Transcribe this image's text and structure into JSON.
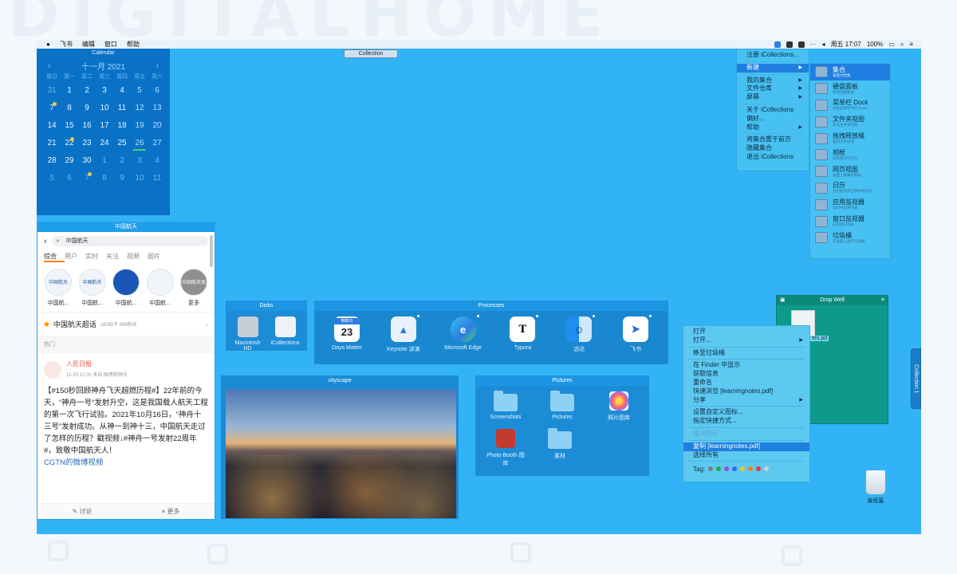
{
  "menubar": {
    "apple": "",
    "app_name": "飞书",
    "menus": [
      "编辑",
      "窗口",
      "帮助"
    ],
    "status_items": [
      "···",
      "周五 17:07",
      "100%"
    ]
  },
  "calendar": {
    "title": "Calendar",
    "month": "十一月 2021",
    "weekdays": [
      "周日",
      "周一",
      "周二",
      "周三",
      "周四",
      "周五",
      "周六"
    ],
    "weeks": [
      [
        "31",
        "1",
        "2",
        "3",
        "4",
        "5",
        "6"
      ],
      [
        "7",
        "8",
        "9",
        "10",
        "11",
        "12",
        "13"
      ],
      [
        "14",
        "15",
        "16",
        "17",
        "18",
        "19",
        "20"
      ],
      [
        "21",
        "22",
        "23",
        "24",
        "25",
        "26",
        "27"
      ],
      [
        "28",
        "29",
        "30",
        "1",
        "2",
        "3",
        "4"
      ],
      [
        "5",
        "6",
        "7",
        "8",
        "9",
        "10",
        "11"
      ]
    ]
  },
  "collection_tab": "Collection",
  "weibo": {
    "title": "中国航天",
    "search": "中国航天",
    "tabs": [
      "综合",
      "用户",
      "实时",
      "关注",
      "视频",
      "图片"
    ],
    "accounts": [
      "中国航...",
      "中国航...",
      "中国航...",
      "中国航...",
      "更多"
    ],
    "avatar_texts": [
      "中国航天",
      "中国航天",
      "",
      "",
      "中国航天局"
    ],
    "topic": "中国航天超话",
    "topic_meta": "283帖子 898粉丝",
    "hot": "热门",
    "poster": "人民日报",
    "post_meta": "11-20 12:00 来自 微博视频号",
    "post_text": "【#150秒回顾神舟飞天超燃历程#】22年前的今天，“神舟一号”发射升空，这是我国载人航天工程的第一次飞行试验。2021年10月16日，“神舟十三号”发射成功。从神一到神十三，中国航天走过了怎样的历程？戳视频↓#神舟一号发射22周年#，致敬中国航天人！",
    "post_link": "CGTN的微博视频",
    "footer": [
      "讨论",
      "更多"
    ]
  },
  "disks": {
    "title": "Disks",
    "items": [
      "Macintosh HD",
      "iCollections"
    ]
  },
  "processes": {
    "title": "Processes",
    "days_matter_icon": {
      "label": "倒数日",
      "day": "23"
    },
    "items": [
      "Days Matter",
      "Keynote 讲演",
      "Microsoft Edge",
      "Typora",
      "访达",
      "飞书"
    ]
  },
  "cityscape": {
    "title": "cityscape"
  },
  "pictures": {
    "title": "Pictures",
    "items": [
      "Screenshots",
      "Pictures",
      "照片图库",
      "Photo Booth 图库",
      "素材"
    ]
  },
  "dropwell": {
    "title": "Drop Well",
    "file_fragment": "tes.pd"
  },
  "context_menu": {
    "items": [
      "打开",
      "打开...",
      "移至垃圾桶",
      "在 Finder 中显示",
      "获取信息",
      "重命名",
      "快速浏览 [learningnotes.pdf]",
      "分享",
      "设置自定义图标...",
      "指定快捷方式...",
      "插入空行",
      "复制 [learningnotes.pdf]",
      "选择所有"
    ],
    "tags_label": "Tag:",
    "tag_colors": [
      "#7d7d7d",
      "#27a844",
      "#9a4ee0",
      "#2d6fe6",
      "#f2c230",
      "#f07d1a",
      "#e23c3c",
      "#cfcfcf"
    ]
  },
  "app_menu": {
    "items": [
      "注册 iCollections...",
      "新建",
      "我的集合",
      "文件仓库",
      "屏幕",
      "关于 iCollections",
      "偏好...",
      "帮助",
      "将集合置于前方",
      "隐藏集合",
      "退出 iCollections"
    ]
  },
  "submenu": {
    "items": [
      {
        "title": "集合",
        "desc": "桌面文档集"
      },
      {
        "title": "硬盘面板",
        "desc": "所选电脑硬盘"
      },
      {
        "title": "菜单栏 Dock",
        "desc": "系统菜单栏中的 Dock"
      },
      {
        "title": "文件夹视图",
        "desc": "所选文件夹内容"
      },
      {
        "title": "拖拽释放桶",
        "desc": "临时文件容器"
      },
      {
        "title": "相框",
        "desc": "您的照片幻灯片"
      },
      {
        "title": "网页视图",
        "desc": "桌面上收藏的网站"
      },
      {
        "title": "日历",
        "desc": "显示您的日历事件的日历"
      },
      {
        "title": "应用监视器",
        "desc": "运行中应用列表"
      },
      {
        "title": "窗口监视器",
        "desc": "应用窗口列表"
      },
      {
        "title": "垃圾桶",
        "desc": "在桌面上显示垃圾桶"
      }
    ]
  },
  "side_tab": "Collection 1",
  "trash": {
    "label": "废纸篓"
  },
  "colors": {
    "desktop": "#32b3f6",
    "accent": "#1f7fe0",
    "calendar_bg": "#0a72c6",
    "dropwell_bg": "#0d9a8a"
  }
}
